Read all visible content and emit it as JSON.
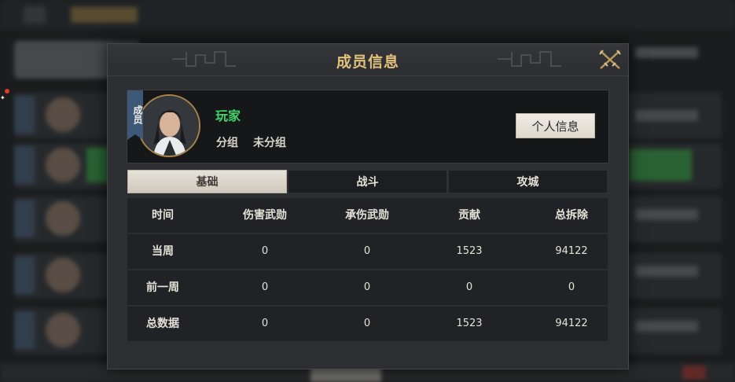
{
  "dialog": {
    "title": "成员信息"
  },
  "profile": {
    "ribbon": "成员",
    "name": "玩家",
    "group_label": "分组",
    "group_value": "未分组",
    "profile_button": "个人信息"
  },
  "tabs": [
    {
      "label": "基础",
      "active": true
    },
    {
      "label": "战斗",
      "active": false
    },
    {
      "label": "攻城",
      "active": false
    }
  ],
  "stats": {
    "headers": [
      "时间",
      "伤害武勋",
      "承伤武勋",
      "贡献",
      "总拆除"
    ],
    "rows": [
      [
        "当周",
        "0",
        "0",
        "1523",
        "94122"
      ],
      [
        "前一周",
        "0",
        "0",
        "0",
        "0"
      ],
      [
        "总数据",
        "0",
        "0",
        "1523",
        "94122"
      ]
    ]
  },
  "colors": {
    "title_gold": "#e2c27a",
    "name_green": "#3ed56b",
    "ribbon_blue": "#3e5878",
    "avatar_border": "#a7854a"
  },
  "icons": {
    "close": "crossed-swords-close-icon"
  }
}
